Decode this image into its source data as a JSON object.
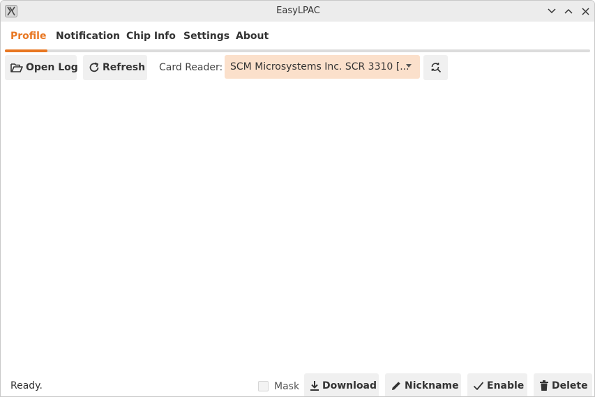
{
  "window": {
    "title": "EasyLPAC",
    "app_icon": "x-logo-icon",
    "controls": [
      "minimize-chevron-icon",
      "maximize-chevron-icon",
      "close-icon"
    ]
  },
  "tabs": [
    {
      "label": "Profile",
      "active": true
    },
    {
      "label": "Notification",
      "active": false
    },
    {
      "label": "Chip Info",
      "active": false
    },
    {
      "label": "Settings",
      "active": false
    },
    {
      "label": "About",
      "active": false
    }
  ],
  "toolbar": {
    "open_log_label": "Open Log",
    "refresh_label": "Refresh",
    "card_reader_label": "Card Reader:",
    "card_reader_value": "SCM Microsystems Inc. SCR 3310 [...",
    "reader_refresh_icon": "refresh-search-icon"
  },
  "status": {
    "text": "Ready.",
    "mask_label": "Mask",
    "mask_checked": false
  },
  "actions": {
    "download_label": "Download",
    "nickname_label": "Nickname",
    "enable_label": "Enable",
    "delete_label": "Delete"
  },
  "colors": {
    "accent": "#e87722",
    "select_bg": "#fbe0cb",
    "button_bg": "#f0f0f0",
    "titlebar_bg": "#ececec"
  }
}
